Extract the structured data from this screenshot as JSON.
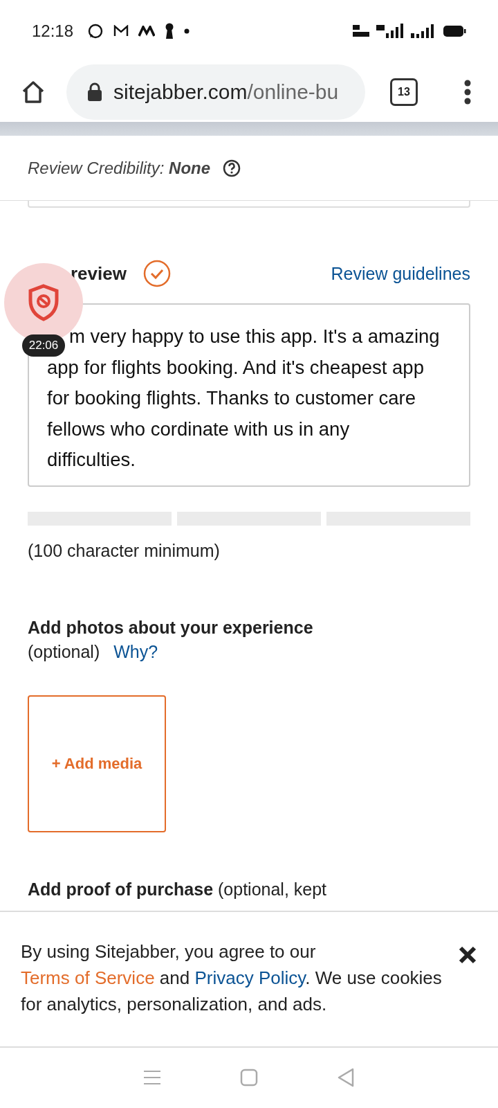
{
  "status_bar": {
    "time": "12:18"
  },
  "browser": {
    "url_host": "sitejabber.com",
    "url_path": "/online-bu",
    "tab_count": "13"
  },
  "credibility": {
    "label": "Review Credibility: **None**"
  },
  "review": {
    "heading": "review",
    "complete": true,
    "guidelines_link": "Review guidelines",
    "text": "m very happy to use this app. It's a amazing app for flights booking. And it's cheapest app for booking flights. Thanks to customer care fellows who cordinate with us in any difficulties.",
    "hint": "(100 character minimum)"
  },
  "photos": {
    "title": "Add photos about your experience",
    "note": "(optional)",
    "why_link": "Why?",
    "add_button": "+ Add media"
  },
  "proof": {
    "text": "**Add proof of purchase** (optional, kept"
  },
  "overlay": {
    "timer": "22:06"
  },
  "cookie_banner": {
    "text_before": "By using Sitejabber, you agree to our ",
    "terms_link": "Terms of Service",
    "text_middle": " and ",
    "privacy_link": "Privacy Policy",
    "text_after": ". We use cookies for analytics, personalization, and ads."
  }
}
